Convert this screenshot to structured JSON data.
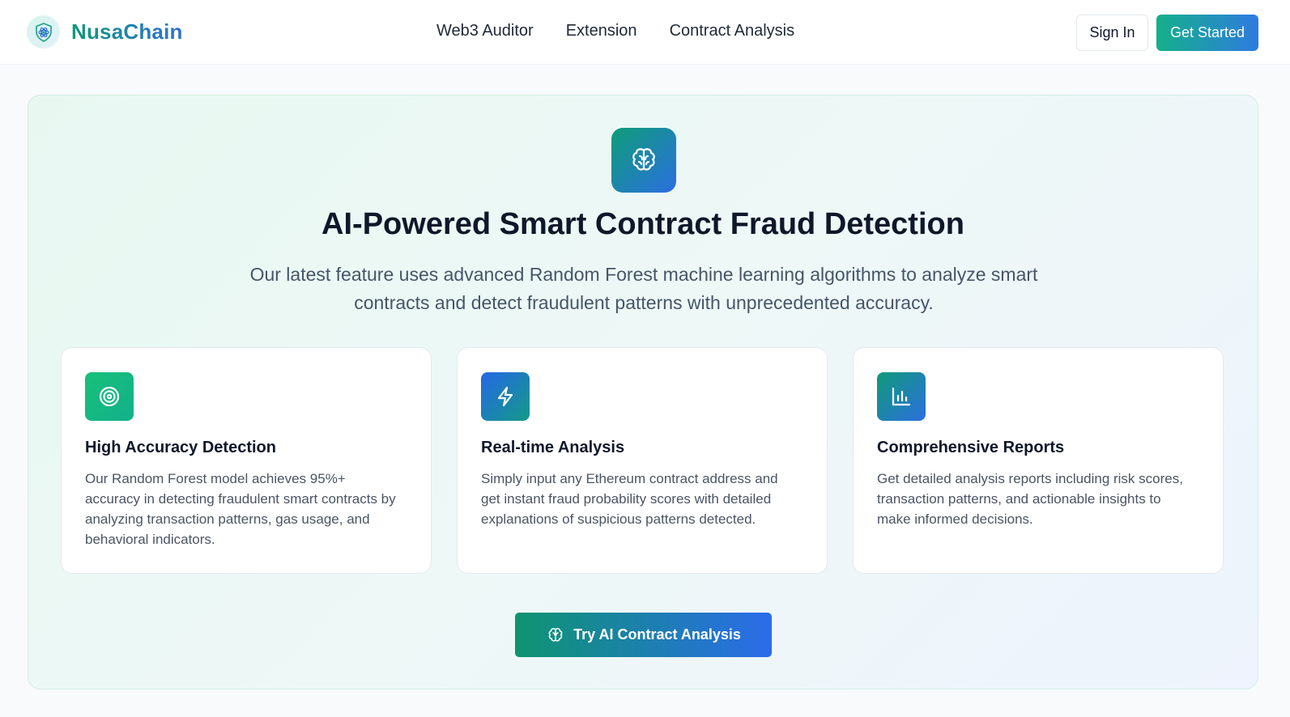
{
  "brand": {
    "name": "NusaChain",
    "logo_icon": "shield-atom-icon"
  },
  "nav": {
    "items": [
      {
        "label": "Web3 Auditor"
      },
      {
        "label": "Extension"
      },
      {
        "label": "Contract Analysis"
      }
    ]
  },
  "auth": {
    "signin_label": "Sign In",
    "getstarted_label": "Get Started"
  },
  "hero": {
    "icon": "brain-icon",
    "title": "AI-Powered Smart Contract Fraud Detection",
    "description": "Our latest feature uses advanced Random Forest machine learning algorithms to analyze smart contracts and detect fraudulent patterns with unprecedented accuracy."
  },
  "features": [
    {
      "icon": "target-icon",
      "title": "High Accuracy Detection",
      "body": "Our Random Forest model achieves 95%+ accuracy in detecting fraudulent smart contracts by analyzing transaction patterns, gas usage, and behavioral indicators."
    },
    {
      "icon": "lightning-icon",
      "title": "Real-time Analysis",
      "body": "Simply input any Ethereum contract address and get instant fraud probability scores with detailed explanations of suspicious patterns detected."
    },
    {
      "icon": "bar-chart-icon",
      "title": "Comprehensive Reports",
      "body": "Get detailed analysis reports including risk scores, transaction patterns, and actionable insights to make informed decisions."
    }
  ],
  "cta": {
    "label": "Try AI Contract Analysis",
    "icon": "brain-icon"
  },
  "colors": {
    "accent_green": "#14b08a",
    "accent_blue": "#2f7be0",
    "text_dark": "#0f172a",
    "text_muted": "#475569"
  }
}
